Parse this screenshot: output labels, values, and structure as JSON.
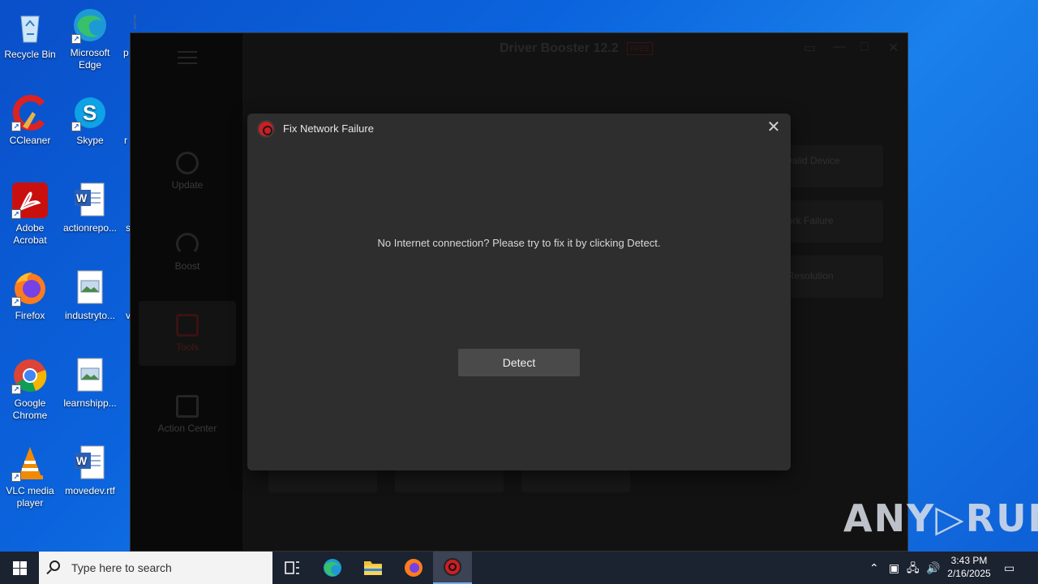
{
  "desktop": {
    "icons": [
      {
        "label": "Recycle Bin"
      },
      {
        "label": "Microsoft Edge"
      },
      {
        "label": "p"
      },
      {
        "label": "CCleaner"
      },
      {
        "label": "Skype"
      },
      {
        "label": "r"
      },
      {
        "label": "Adobe Acrobat"
      },
      {
        "label": "actionrepo..."
      },
      {
        "label": "s"
      },
      {
        "label": "Firefox"
      },
      {
        "label": "industryto..."
      },
      {
        "label": "v"
      },
      {
        "label": "Google Chrome"
      },
      {
        "label": "learnshipp..."
      },
      {
        "label": "VLC media player"
      },
      {
        "label": "movedev.rtf"
      }
    ]
  },
  "app": {
    "title": "Driver Booster 12.2",
    "badge": "FREE",
    "sidebar": [
      {
        "label": "Update"
      },
      {
        "label": "Boost"
      },
      {
        "label": "Tools"
      },
      {
        "label": "Action Center"
      }
    ],
    "tool_cards": [
      {
        "label": "valid Device"
      },
      {
        "label": "ork Failure"
      },
      {
        "label": "Resolution"
      }
    ]
  },
  "dialog": {
    "title": "Fix Network Failure",
    "message": "No Internet connection? Please try to fix it by clicking Detect.",
    "button": "Detect",
    "close_icon": "close-icon"
  },
  "taskbar": {
    "search_placeholder": "Type here to search",
    "time": "3:43 PM",
    "date": "2/16/2025"
  },
  "watermark": "ANY▷RUN"
}
